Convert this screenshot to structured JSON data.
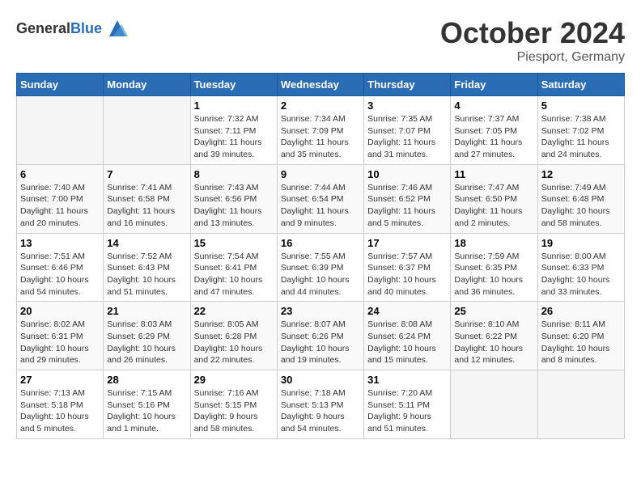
{
  "header": {
    "logo_general": "General",
    "logo_blue": "Blue",
    "month": "October 2024",
    "location": "Piesport, Germany"
  },
  "weekdays": [
    "Sunday",
    "Monday",
    "Tuesday",
    "Wednesday",
    "Thursday",
    "Friday",
    "Saturday"
  ],
  "weeks": [
    [
      {
        "day": "",
        "info": ""
      },
      {
        "day": "",
        "info": ""
      },
      {
        "day": "1",
        "info": "Sunrise: 7:32 AM\nSunset: 7:11 PM\nDaylight: 11 hours and 39 minutes."
      },
      {
        "day": "2",
        "info": "Sunrise: 7:34 AM\nSunset: 7:09 PM\nDaylight: 11 hours and 35 minutes."
      },
      {
        "day": "3",
        "info": "Sunrise: 7:35 AM\nSunset: 7:07 PM\nDaylight: 11 hours and 31 minutes."
      },
      {
        "day": "4",
        "info": "Sunrise: 7:37 AM\nSunset: 7:05 PM\nDaylight: 11 hours and 27 minutes."
      },
      {
        "day": "5",
        "info": "Sunrise: 7:38 AM\nSunset: 7:02 PM\nDaylight: 11 hours and 24 minutes."
      }
    ],
    [
      {
        "day": "6",
        "info": "Sunrise: 7:40 AM\nSunset: 7:00 PM\nDaylight: 11 hours and 20 minutes."
      },
      {
        "day": "7",
        "info": "Sunrise: 7:41 AM\nSunset: 6:58 PM\nDaylight: 11 hours and 16 minutes."
      },
      {
        "day": "8",
        "info": "Sunrise: 7:43 AM\nSunset: 6:56 PM\nDaylight: 11 hours and 13 minutes."
      },
      {
        "day": "9",
        "info": "Sunrise: 7:44 AM\nSunset: 6:54 PM\nDaylight: 11 hours and 9 minutes."
      },
      {
        "day": "10",
        "info": "Sunrise: 7:46 AM\nSunset: 6:52 PM\nDaylight: 11 hours and 5 minutes."
      },
      {
        "day": "11",
        "info": "Sunrise: 7:47 AM\nSunset: 6:50 PM\nDaylight: 11 hours and 2 minutes."
      },
      {
        "day": "12",
        "info": "Sunrise: 7:49 AM\nSunset: 6:48 PM\nDaylight: 10 hours and 58 minutes."
      }
    ],
    [
      {
        "day": "13",
        "info": "Sunrise: 7:51 AM\nSunset: 6:46 PM\nDaylight: 10 hours and 54 minutes."
      },
      {
        "day": "14",
        "info": "Sunrise: 7:52 AM\nSunset: 6:43 PM\nDaylight: 10 hours and 51 minutes."
      },
      {
        "day": "15",
        "info": "Sunrise: 7:54 AM\nSunset: 6:41 PM\nDaylight: 10 hours and 47 minutes."
      },
      {
        "day": "16",
        "info": "Sunrise: 7:55 AM\nSunset: 6:39 PM\nDaylight: 10 hours and 44 minutes."
      },
      {
        "day": "17",
        "info": "Sunrise: 7:57 AM\nSunset: 6:37 PM\nDaylight: 10 hours and 40 minutes."
      },
      {
        "day": "18",
        "info": "Sunrise: 7:59 AM\nSunset: 6:35 PM\nDaylight: 10 hours and 36 minutes."
      },
      {
        "day": "19",
        "info": "Sunrise: 8:00 AM\nSunset: 6:33 PM\nDaylight: 10 hours and 33 minutes."
      }
    ],
    [
      {
        "day": "20",
        "info": "Sunrise: 8:02 AM\nSunset: 6:31 PM\nDaylight: 10 hours and 29 minutes."
      },
      {
        "day": "21",
        "info": "Sunrise: 8:03 AM\nSunset: 6:29 PM\nDaylight: 10 hours and 26 minutes."
      },
      {
        "day": "22",
        "info": "Sunrise: 8:05 AM\nSunset: 6:28 PM\nDaylight: 10 hours and 22 minutes."
      },
      {
        "day": "23",
        "info": "Sunrise: 8:07 AM\nSunset: 6:26 PM\nDaylight: 10 hours and 19 minutes."
      },
      {
        "day": "24",
        "info": "Sunrise: 8:08 AM\nSunset: 6:24 PM\nDaylight: 10 hours and 15 minutes."
      },
      {
        "day": "25",
        "info": "Sunrise: 8:10 AM\nSunset: 6:22 PM\nDaylight: 10 hours and 12 minutes."
      },
      {
        "day": "26",
        "info": "Sunrise: 8:11 AM\nSunset: 6:20 PM\nDaylight: 10 hours and 8 minutes."
      }
    ],
    [
      {
        "day": "27",
        "info": "Sunrise: 7:13 AM\nSunset: 5:18 PM\nDaylight: 10 hours and 5 minutes."
      },
      {
        "day": "28",
        "info": "Sunrise: 7:15 AM\nSunset: 5:16 PM\nDaylight: 10 hours and 1 minute."
      },
      {
        "day": "29",
        "info": "Sunrise: 7:16 AM\nSunset: 5:15 PM\nDaylight: 9 hours and 58 minutes."
      },
      {
        "day": "30",
        "info": "Sunrise: 7:18 AM\nSunset: 5:13 PM\nDaylight: 9 hours and 54 minutes."
      },
      {
        "day": "31",
        "info": "Sunrise: 7:20 AM\nSunset: 5:11 PM\nDaylight: 9 hours and 51 minutes."
      },
      {
        "day": "",
        "info": ""
      },
      {
        "day": "",
        "info": ""
      }
    ]
  ]
}
